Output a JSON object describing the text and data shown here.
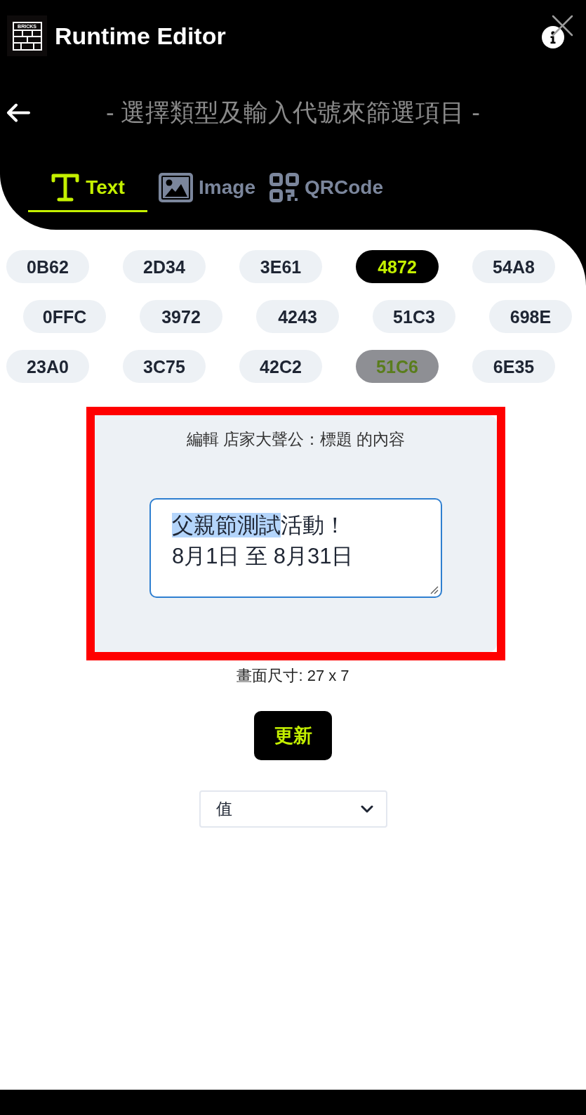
{
  "header": {
    "logo_text": "BRICKS",
    "title": "Runtime Editor"
  },
  "subtitle": "- 選擇類型及輸入代號來篩選項目 -",
  "tabs": [
    {
      "kind": "text",
      "label": "Text",
      "selected": true
    },
    {
      "kind": "image",
      "label": "Image",
      "selected": false
    },
    {
      "kind": "qrcode",
      "label": "QRCode",
      "selected": false
    }
  ],
  "code_rows": [
    {
      "codes": [
        {
          "code": "0B62",
          "selected": false,
          "disabled": false
        },
        {
          "code": "2D34",
          "selected": false,
          "disabled": false
        },
        {
          "code": "3E61",
          "selected": false,
          "disabled": false
        },
        {
          "code": "4872",
          "selected": true,
          "disabled": false
        },
        {
          "code": "54A8",
          "selected": false,
          "disabled": false
        }
      ]
    },
    {
      "codes": [
        {
          "code": "0FFC",
          "selected": false,
          "disabled": false
        },
        {
          "code": "3972",
          "selected": false,
          "disabled": false
        },
        {
          "code": "4243",
          "selected": false,
          "disabled": false
        },
        {
          "code": "51C3",
          "selected": false,
          "disabled": false
        },
        {
          "code": "698E",
          "selected": false,
          "disabled": false
        }
      ]
    },
    {
      "codes": [
        {
          "code": "23A0",
          "selected": false,
          "disabled": false
        },
        {
          "code": "3C75",
          "selected": false,
          "disabled": false
        },
        {
          "code": "42C2",
          "selected": false,
          "disabled": false
        },
        {
          "code": "51C6",
          "selected": false,
          "disabled": true
        },
        {
          "code": "6E35",
          "selected": false,
          "disabled": false
        }
      ]
    }
  ],
  "editor": {
    "highlighted": true,
    "title": "編輯 店家大聲公：標題 的內容",
    "value_parts": [
      {
        "text": "父親節測試",
        "selected": true
      },
      {
        "text": "活動！\n8月1日 至 8月31日",
        "selected": false
      }
    ]
  },
  "canvas_size": "畫面尺寸: 27 x 7",
  "update_button": "更新",
  "select": {
    "value": "值"
  }
}
